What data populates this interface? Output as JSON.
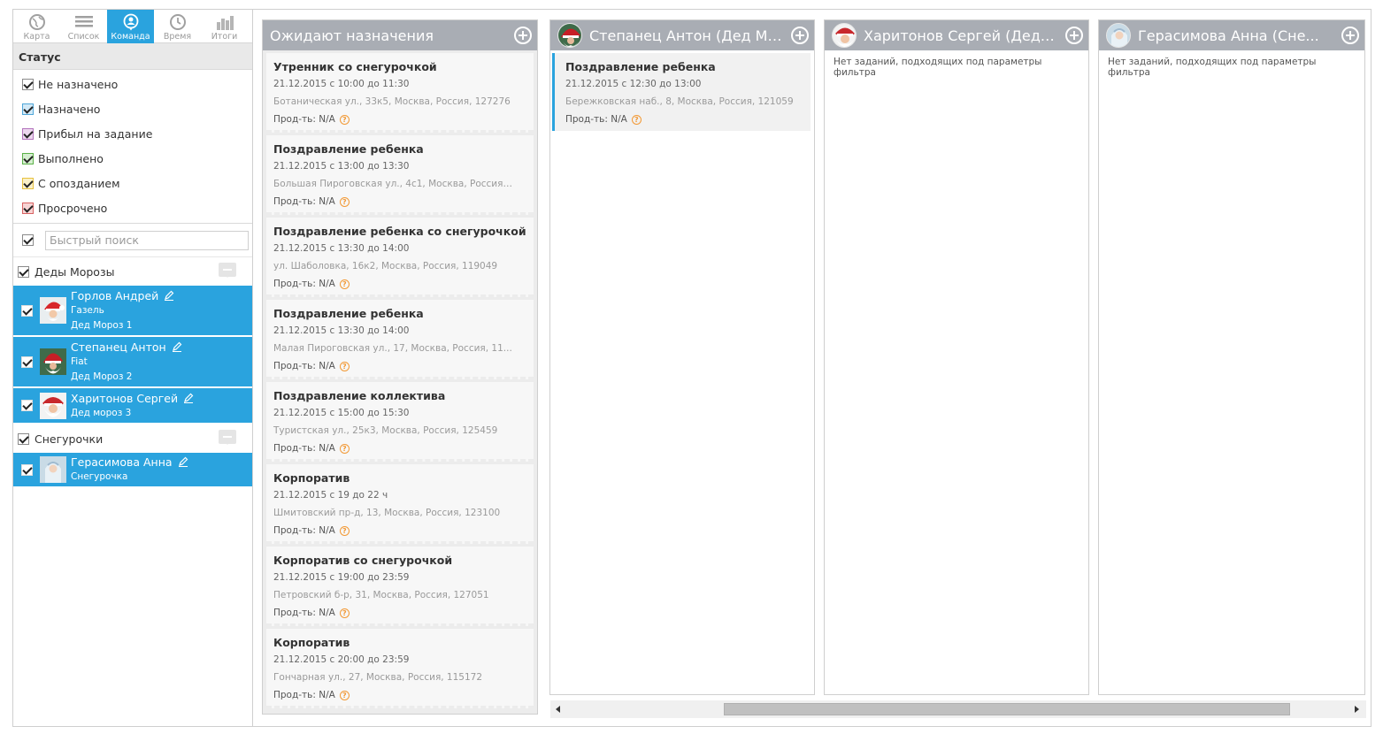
{
  "view_tabs": [
    {
      "label": "Карта",
      "icon": "globe-icon"
    },
    {
      "label": "Список",
      "icon": "list-icon"
    },
    {
      "label": "Команда",
      "icon": "team-pin-icon",
      "active": true
    },
    {
      "label": "Время",
      "icon": "clock-icon"
    },
    {
      "label": "Итоги",
      "icon": "bar-chart-icon"
    }
  ],
  "status": {
    "title": "Статус",
    "items": [
      {
        "label": "Не назначено",
        "checked": true,
        "color": "#9e9e9e"
      },
      {
        "label": "Назначено",
        "checked": true,
        "color": "#4fa6d8"
      },
      {
        "label": "Прибыл на задание",
        "checked": true,
        "color": "#b374bd"
      },
      {
        "label": "Выполнено",
        "checked": true,
        "color": "#5bb148"
      },
      {
        "label": "С опозданием",
        "checked": true,
        "color": "#e7c13e"
      },
      {
        "label": "Просрочено",
        "checked": true,
        "color": "#d76161"
      }
    ]
  },
  "search": {
    "placeholder": "Быстрый поиск"
  },
  "groups": [
    {
      "name": "Деды Морозы",
      "members": [
        {
          "name": "Горлов Андрей",
          "vehicle": "Газель",
          "role": "Дед Мороз 1"
        },
        {
          "name": "Степанец Антон",
          "vehicle": "Fiat",
          "role": "Дед Мороз 2"
        },
        {
          "name": "Харитонов Сергей",
          "vehicle": "",
          "role": "Дед мороз 3"
        }
      ]
    },
    {
      "name": "Снегурочки",
      "members": [
        {
          "name": "Герасимова Анна",
          "vehicle": "",
          "role": "Снегурочка"
        }
      ]
    }
  ],
  "pending": {
    "title": "Ожидают назначения",
    "tasks": [
      {
        "title": "Утренник со снегурочкой",
        "time": "21.12.2015 с 10:00 до 11:30",
        "address": "Ботаническая ул., 33к5, Москва, Россия, 127276",
        "prod": "Прод-ть: N/A"
      },
      {
        "title": "Поздравление ребенка",
        "time": "21.12.2015 с 13:00 до 13:30",
        "address": "Большая Пироговская ул., 4с1, Москва, Россия...   .",
        "prod": "Прод-ть: N/A"
      },
      {
        "title": "Поздравление ребенка со снегурочкой",
        "time": "21.12.2015 с 13:30 до 14:00",
        "address": "ул. Шаболовка, 16к2, Москва, Россия, 119049",
        "prod": "Прод-ть: N/A"
      },
      {
        "title": "Поздравление ребенка",
        "time": "21.12.2015 с 13:30 до 14:00",
        "address": "Малая Пироговская ул., 17, Москва, Россия, 11...",
        "prod": "Прод-ть: N/A"
      },
      {
        "title": "Поздравление коллектива",
        "time": "21.12.2015 с 15:00 до 15:30",
        "address": "Туристская ул., 25к3, Москва, Россия, 125459",
        "prod": "Прод-ть: N/A"
      },
      {
        "title": "Корпоратив",
        "time": "21.12.2015 с 19 до 22 ч",
        "address": "Шмитовский пр-д, 13, Москва, Россия, 123100",
        "prod": "Прод-ть: N/A"
      },
      {
        "title": "Корпоратив со снегурочкой",
        "time": "21.12.2015 с 19:00 до 23:59",
        "address": "Петровский б-р, 31, Москва, Россия, 127051",
        "prod": "Прод-ть: N/A"
      },
      {
        "title": "Корпоратив",
        "time": "21.12.2015 с 20:00 до 23:59",
        "address": "Гончарная ул., 27, Москва, Россия, 115172",
        "prod": "Прод-ть: N/A"
      }
    ]
  },
  "columns": [
    {
      "title": "Степанец Антон (Дед Мороз ...",
      "tasks": [
        {
          "title": "Поздравление ребенка",
          "time": "21.12.2015 с 12:30 до 13:00",
          "address": "Бережковская наб., 8, Москва, Россия, 121059",
          "prod": "Прод-ть: N/A"
        }
      ],
      "empty": ""
    },
    {
      "title": "Харитонов Сергей (Дед мор...",
      "tasks": [],
      "empty": "Нет заданий, подходящих под параметры фильтра"
    },
    {
      "title": "Герасимова Анна (Сне...",
      "tasks": [],
      "empty": "Нет заданий, подходящих под параметры фильтра"
    }
  ],
  "colors": {
    "accent": "#2aa3de",
    "column_header": "#a9adb4",
    "help_icon": "#f29935"
  }
}
